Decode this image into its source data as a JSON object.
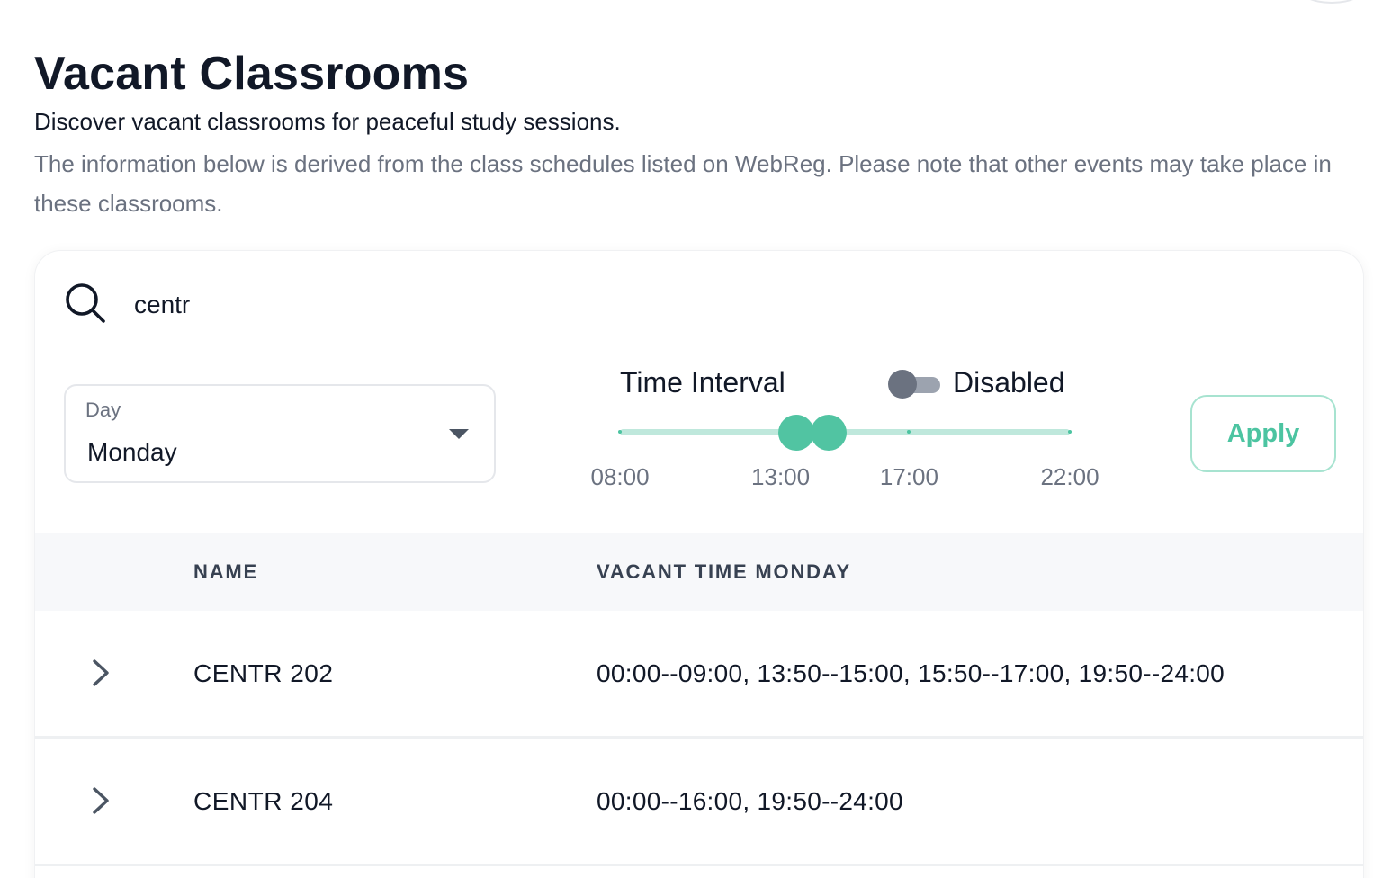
{
  "header": {
    "title": "Vacant Classrooms",
    "subtitle": "Discover vacant classrooms for peaceful study sessions.",
    "note": "The information below is derived from the class schedules listed on WebReg. Please note that other events may take place in these classrooms."
  },
  "search": {
    "value": "centr",
    "icon": "search-icon"
  },
  "filters": {
    "day_label": "Day",
    "day_value": "Monday",
    "time_interval_label": "Time Interval",
    "toggle_enabled": false,
    "toggle_label": "Disabled",
    "slider": {
      "min": 8,
      "max": 22,
      "range_start": 13.5,
      "range_end": 14.5,
      "marks": [
        {
          "value": 8,
          "label": "08:00"
        },
        {
          "value": 13,
          "label": "13:00"
        },
        {
          "value": 17,
          "label": "17:00"
        },
        {
          "value": 22,
          "label": "22:00"
        }
      ]
    },
    "apply_label": "Apply"
  },
  "table": {
    "columns": [
      "NAME",
      "VACANT TIME MONDAY"
    ],
    "rows": [
      {
        "name": "CENTR 202",
        "times": "00:00--09:00, 13:50--15:00, 15:50--17:00, 19:50--24:00"
      },
      {
        "name": "CENTR 204",
        "times": "00:00--16:00, 19:50--24:00"
      }
    ]
  },
  "colors": {
    "accent": "#51c4a2",
    "accent_light": "#bfe8dc",
    "text_primary": "#111827",
    "text_muted": "#6b7280",
    "header_bg": "#f7f8fa"
  }
}
